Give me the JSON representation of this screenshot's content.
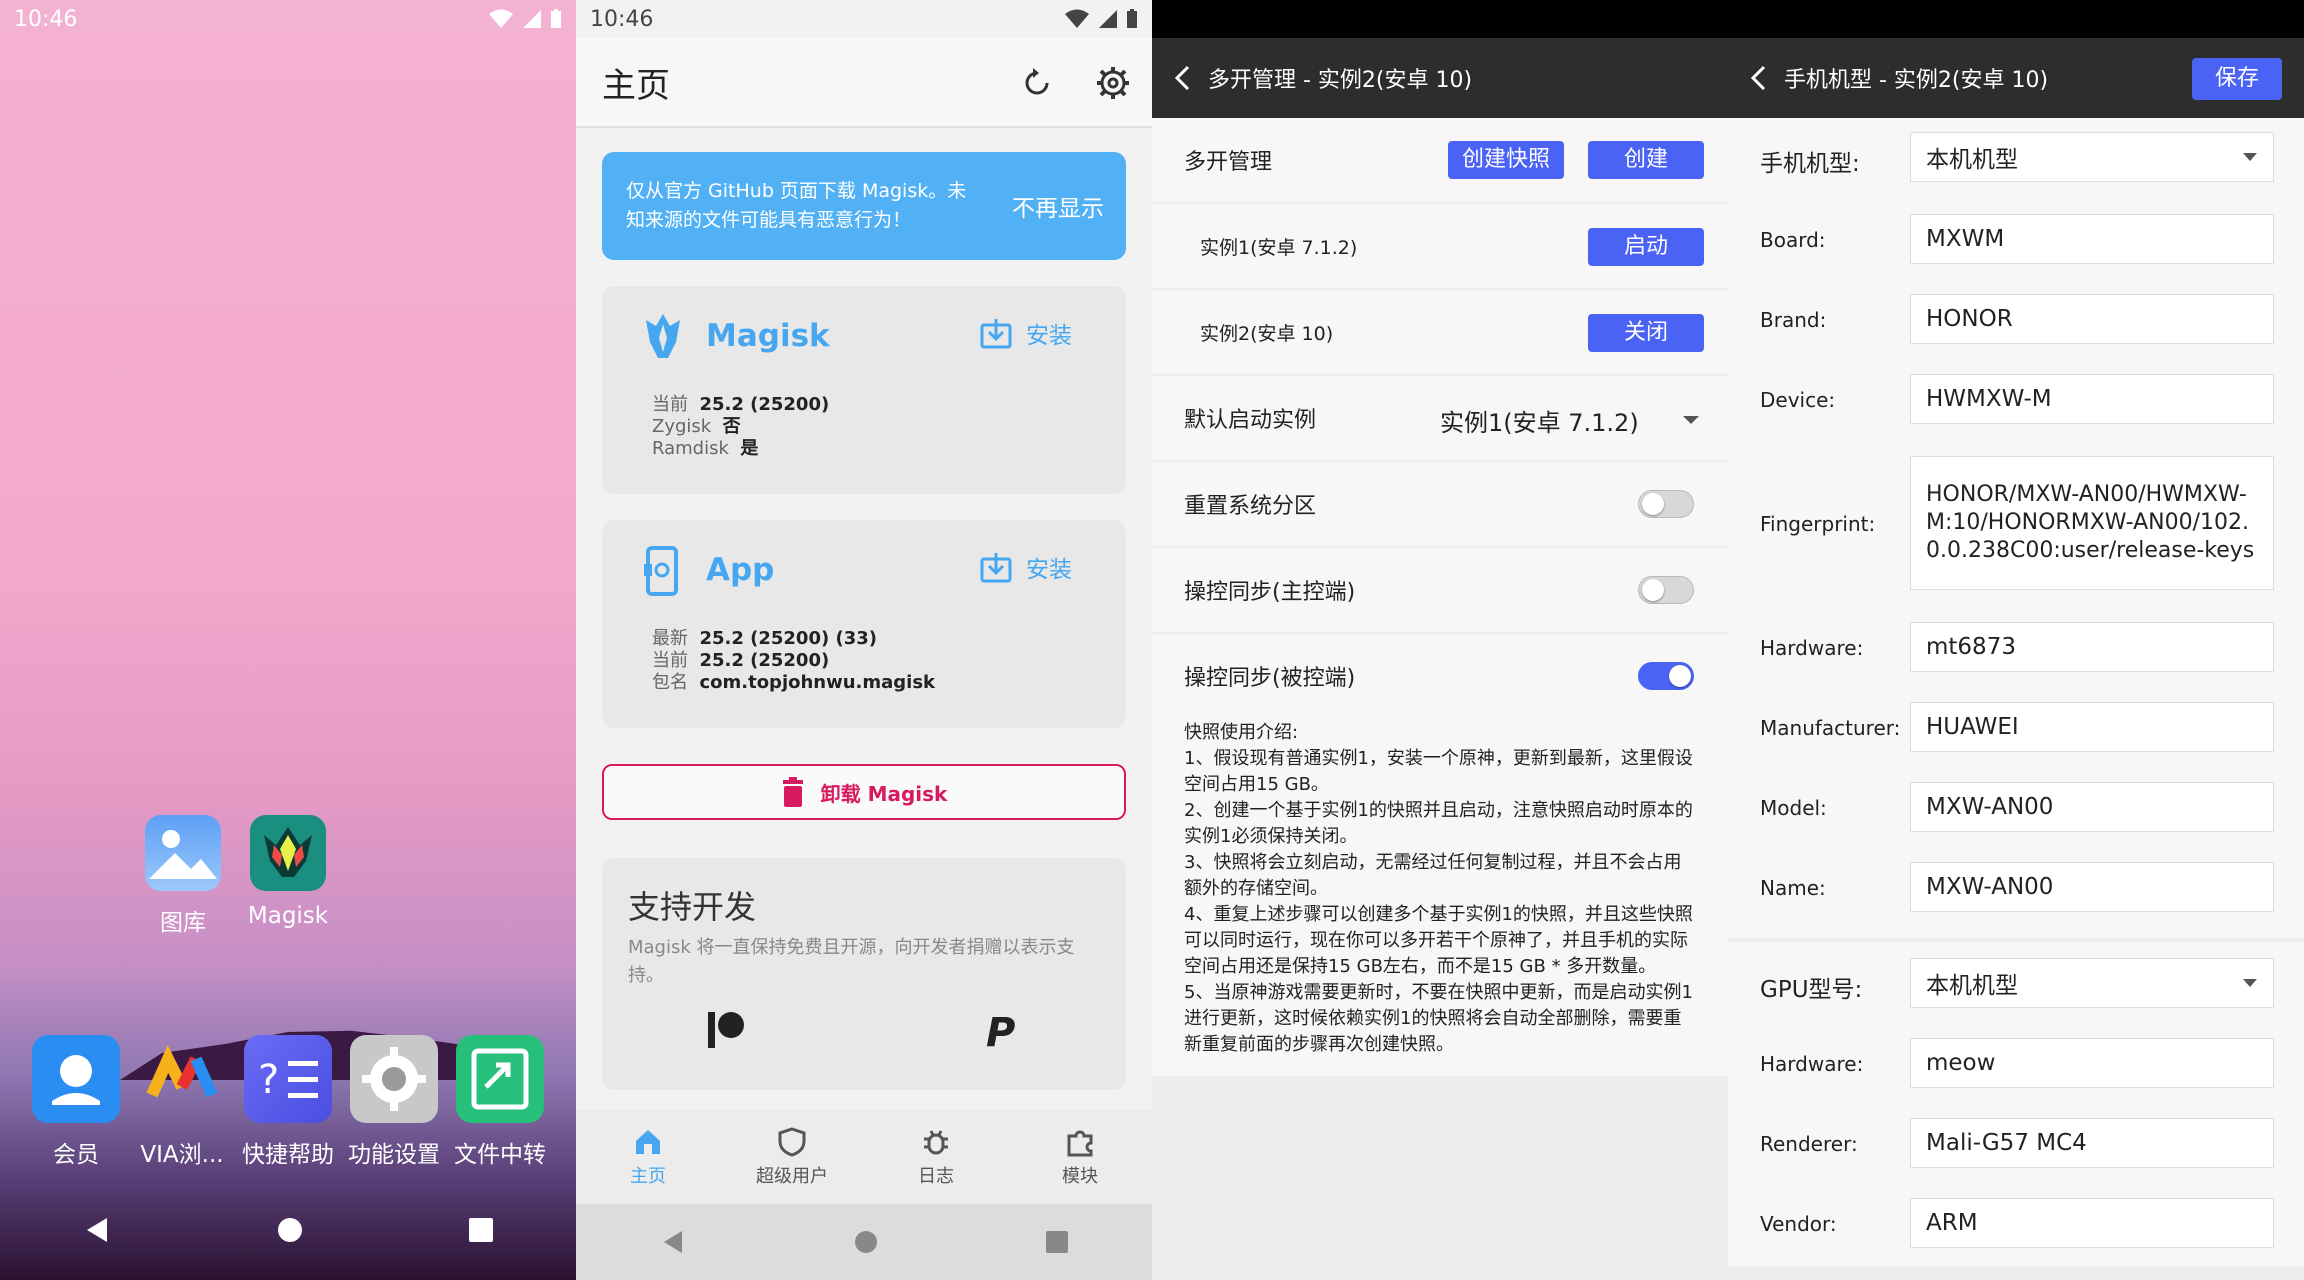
{
  "p1": {
    "time": "10:46",
    "apps_mid": [
      {
        "label": "图库",
        "icon": "gallery-icon"
      },
      {
        "label": "Magisk",
        "icon": "magisk-app-icon"
      }
    ],
    "dock": [
      {
        "label": "会员",
        "icon": "member-icon"
      },
      {
        "label": "VIA浏...",
        "icon": "via-browser-icon"
      },
      {
        "label": "快捷帮助",
        "icon": "quick-help-icon"
      },
      {
        "label": "功能设置",
        "icon": "settings-gear-icon"
      },
      {
        "label": "文件中转",
        "icon": "file-transfer-icon"
      }
    ]
  },
  "p2": {
    "time": "10:46",
    "title": "主页",
    "notice": "仅从官方 GitHub 页面下载 Magisk。未知来源的文件可能具有恶意行为！",
    "dismiss": "不再显示",
    "magisk": {
      "name": "Magisk",
      "install": "安装",
      "rows": [
        {
          "k": "当前",
          "v": "25.2 (25200)"
        },
        {
          "k": "Zygisk",
          "v": "否"
        },
        {
          "k": "Ramdisk",
          "v": "是"
        }
      ]
    },
    "app": {
      "name": "App",
      "install": "安装",
      "rows": [
        {
          "k": "最新",
          "v": "25.2 (25200) (33)"
        },
        {
          "k": "当前",
          "v": "25.2 (25200)"
        },
        {
          "k": "包名",
          "v": "com.topjohnwu.magisk"
        }
      ]
    },
    "uninstall": "卸载 Magisk",
    "support_title": "支持开发",
    "support_text": "Magisk 将一直保持免费且开源，向开发者捐赠以表示支持。",
    "tabs": [
      "主页",
      "超级用户",
      "日志",
      "模块"
    ],
    "colors": {
      "accent": "#46a7f0",
      "danger": "#d81b60"
    }
  },
  "p3": {
    "title": "多开管理 - 实例2(安卓 10)",
    "header_label": "多开管理",
    "btn_snapshot": "创建快照",
    "btn_create": "创建",
    "instances": [
      {
        "name": "实例1(安卓 7.1.2)",
        "action": "启动"
      },
      {
        "name": "实例2(安卓 10)",
        "action": "关闭"
      }
    ],
    "default_label": "默认启动实例",
    "default_value": "实例1(安卓 7.1.2)",
    "toggles": [
      {
        "label": "重置系统分区",
        "on": false
      },
      {
        "label": "操控同步(主控端)",
        "on": false
      },
      {
        "label": "操控同步(被控端)",
        "on": true
      }
    ],
    "intro": [
      "快照使用介绍:",
      "1、假设现有普通实例1，安装一个原神，更新到最新，这里假设空间占用15 GB。",
      "2、创建一个基于实例1的快照并且启动，注意快照启动时原本的实例1必须保持关闭。",
      "3、快照将会立刻启动，无需经过任何复制过程，并且不会占用额外的存储空间。",
      "4、重复上述步骤可以创建多个基于实例1的快照，并且这些快照可以同时运行，现在你可以多开若干个原神了，并且手机的实际空间占用还是保持15 GB左右，而不是15 GB * 多开数量。",
      "5、当原神游戏需要更新时，不要在快照中更新，而是启动实例1进行更新，这时候依赖实例1的快照将会自动全部删除，需要重新重复前面的步骤再次创建快照。"
    ]
  },
  "p4": {
    "title": "手机机型 - 实例2(安卓 10)",
    "save": "保存",
    "model_label": "手机机型:",
    "model_value": "本机机型",
    "fields": [
      {
        "k": "Board:",
        "v": "MXWM"
      },
      {
        "k": "Brand:",
        "v": "HONOR"
      },
      {
        "k": "Device:",
        "v": "HWMXW-M"
      },
      {
        "k": "Fingerprint:",
        "v": "HONOR/MXW-AN00/HWMXW-M:10/HONORMXW-AN00/102.0.0.238C00:user/release-keys"
      },
      {
        "k": "Hardware:",
        "v": "mt6873"
      },
      {
        "k": "Manufacturer:",
        "v": "HUAWEI"
      },
      {
        "k": "Model:",
        "v": "MXW-AN00"
      },
      {
        "k": "Name:",
        "v": "MXW-AN00"
      }
    ],
    "gpu_label": "GPU型号:",
    "gpu_value": "本机机型",
    "gpu_fields": [
      {
        "k": "Hardware:",
        "v": "meow"
      },
      {
        "k": "Renderer:",
        "v": "Mali-G57 MC4"
      },
      {
        "k": "Vendor:",
        "v": "ARM"
      }
    ]
  }
}
